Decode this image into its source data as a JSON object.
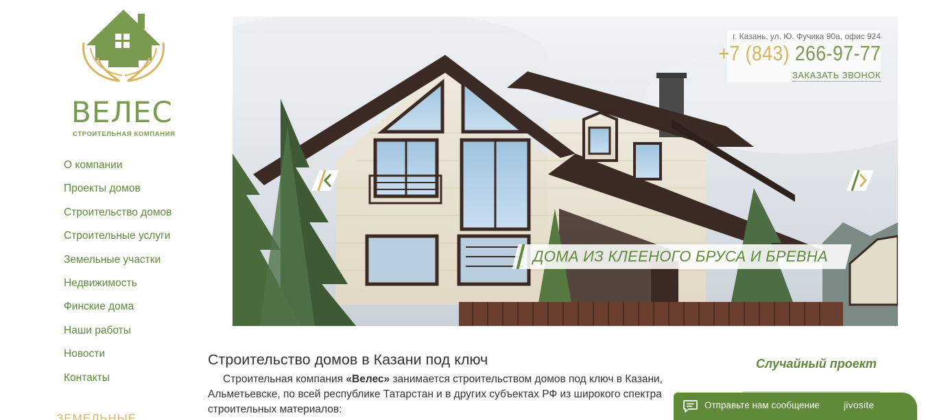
{
  "logo": {
    "name": "ВЕЛЕС",
    "subtitle": "СТРОИТЕЛЬНАЯ КОМПАНИЯ"
  },
  "nav": [
    "О компании",
    "Проекты домов",
    "Строительство домов",
    "Строительные услуги",
    "Земельные участки",
    "Недвижимость",
    "Финские дома",
    "Наши работы",
    "Новости",
    "Контакты"
  ],
  "side_heading": "ЗЕМЕЛЬНЫЕ",
  "contact": {
    "address": "г. Казань, ул. Ю. Фучика 90а, офис 924",
    "phone_code": "+7 (843)",
    "phone_number": "266-97-77",
    "callback": "ЗАКАЗАТЬ ЗВОНОК"
  },
  "slider": {
    "caption": "ДОМА ИЗ КЛЕЕНОГО БРУСА И БРЕВНА"
  },
  "main": {
    "title": "Строительство домов в Казани под ключ",
    "intro_before": "Строительная компания ",
    "intro_bold": "«Велес»",
    "intro_after": " занимается строительством домов под ключ в Казани, Альметьевске, по всей республике Татарстан и в других субъектах РФ из широкого спектра строительных материалов:"
  },
  "random_project": {
    "title": "Случайный проект"
  },
  "chat": {
    "message": "Отправьте нам сообщение",
    "brand": "jivosite"
  },
  "colors": {
    "brand_green": "#5e8a3a",
    "brand_gold": "#d6b55e"
  },
  "icons": [
    "house-hands-logo-icon",
    "arrow-left-icon",
    "arrow-right-icon",
    "chat-bubble-icon"
  ]
}
